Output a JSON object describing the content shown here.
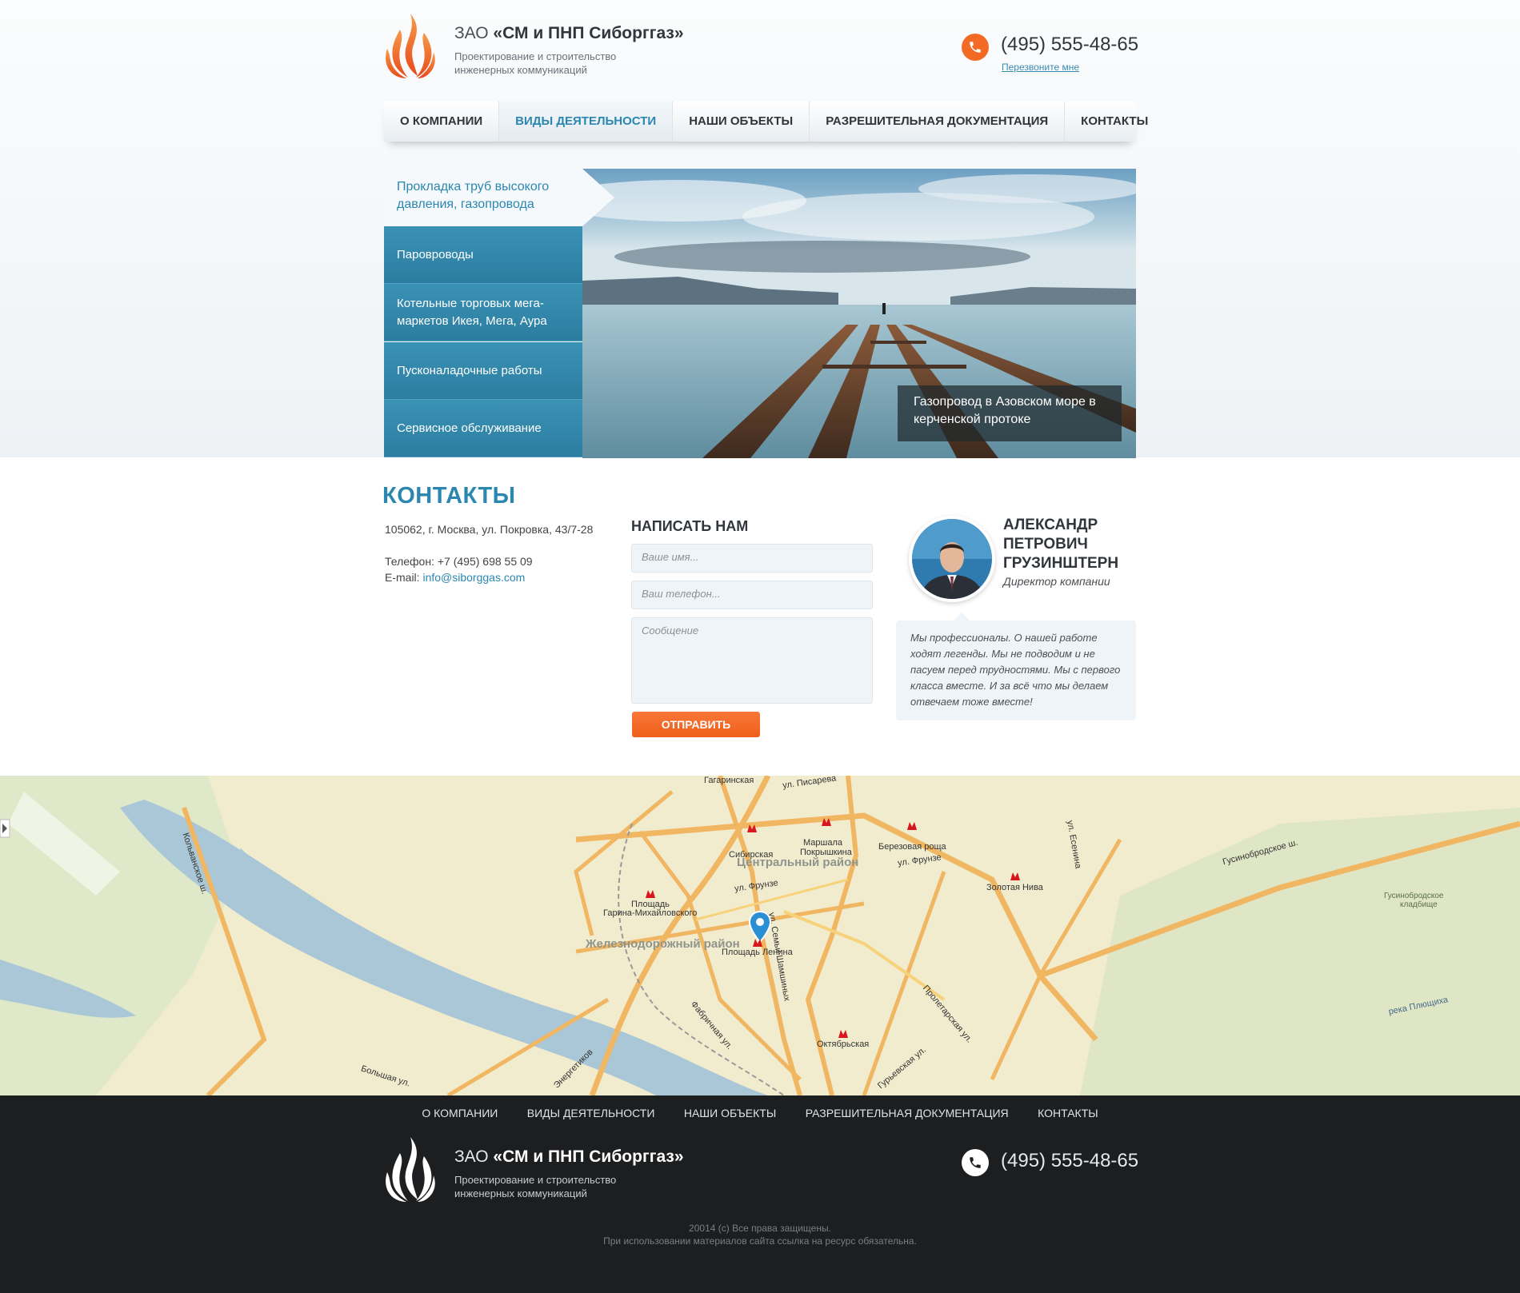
{
  "header": {
    "company_prefix": "ЗАО",
    "company_name": "«СМ и ПНП Сиборггаз»",
    "company_desc_1": "Проектирование и строительство",
    "company_desc_2": "инженерных коммуникаций",
    "phone": "(495) 555-48-65",
    "callback": "Перезвоните мне"
  },
  "nav": {
    "items": [
      {
        "label": "О КОМПАНИИ"
      },
      {
        "label": "ВИДЫ ДЕЯТЕЛЬНОСТИ"
      },
      {
        "label": "НАШИ ОБЪЕКТЫ"
      },
      {
        "label": "РАЗРЕШИТЕЛЬНАЯ ДОКУМЕНТАЦИЯ"
      },
      {
        "label": "КОНТАКТЫ"
      }
    ],
    "active_index": 1
  },
  "hero": {
    "active_item": "Прокладка труб высокого давления, газопровода",
    "items": [
      {
        "label": "Паровроводы"
      },
      {
        "label": "Котельные торговых мега-маркетов Икея, Мега, Аура"
      },
      {
        "label": "Пусконаладочные работы"
      },
      {
        "label": "Сервисное обслуживание"
      }
    ],
    "caption": "Газопровод в Азовском море в керченской протоке"
  },
  "contacts": {
    "title": "КОНТАКТЫ",
    "address": "105062, г. Москва, ул. Покровка, 43/7-28",
    "phone": "Телефон: +7 (495) 698 55 09",
    "email_label": "E-mail: ",
    "email": "info@siborggas.com"
  },
  "form": {
    "title": "НАПИСАТЬ НАМ",
    "name_placeholder": "Ваше имя...",
    "phone_placeholder": "Ваш телефон...",
    "message_placeholder": "Сообщение",
    "submit": "ОТПРАВИТЬ"
  },
  "director": {
    "name_1": "АЛЕКСАНДР",
    "name_2": "ПЕТРОВИЧ",
    "name_3": "ГРУЗИНШТЕРН",
    "role": "Директор компании",
    "quote": "Мы профессионалы. О нашей работе ходят легенды. Мы не подводим и не пасуем перед трудностями. Мы с первого класса вместе. И за всё что мы делаем отвечаем тоже вместе!"
  },
  "map": {
    "labels": {
      "gagarinskaya": "Гагаринская",
      "pisareva": "ул. Писарева",
      "sibirskaya": "Сибирская",
      "marshala": "Маршала",
      "pokryshkina": "Покрышкина",
      "berezovaya": "Березовая роща",
      "central": "Центральный район",
      "frunze1": "ул. Фрунзе",
      "frunze2": "ул. Фрунзе",
      "zolotaya": "Золотая Нива",
      "garina1": "Площадь",
      "garina2": "Гарина-Михайловского",
      "railway": "Железнодорожный район",
      "lenina": "Площадь Ленина",
      "semyi": "ул. Семьи Шамшиных",
      "oktyabrskaya": "Октябрьская",
      "gusino": "Гусинобродское ш.",
      "gusino_cem1": "Гусинобродское",
      "gusino_cem2": "кладбище",
      "plyushka": "река Плющиха",
      "proletarskaya": "Пролетарская ул.",
      "fabrichnaya": "Фабричная ул.",
      "energetikov": "Энергетиков",
      "bolshaya": "Большая ул.",
      "kolyvanskoe": "Кольванское ш.",
      "esenina": "ул. Есенина",
      "guryevskaya": "Гурьевская ул."
    }
  },
  "footer": {
    "nav": [
      "О КОМПАНИИ",
      "ВИДЫ ДЕЯТЕЛЬНОСТИ",
      "НАШИ ОБЪЕКТЫ",
      "РАЗРЕШИТЕЛЬНАЯ ДОКУМЕНТАЦИЯ",
      "КОНТАКТЫ"
    ],
    "company_prefix": "ЗАО",
    "company_name": "«СМ и ПНП Сиборггаз»",
    "company_desc_1": "Проектирование и строительство",
    "company_desc_2": "инженерных коммуникаций",
    "phone": "(495) 555-48-65",
    "copyright_1": "20014 (с) Все права защищены.",
    "copyright_2": "При использовании материалов сайта ссылка на ресурс обязательна."
  },
  "colors": {
    "accent": "#2b87b0",
    "orange": "#f36a24",
    "footer": "#1d1e20"
  }
}
